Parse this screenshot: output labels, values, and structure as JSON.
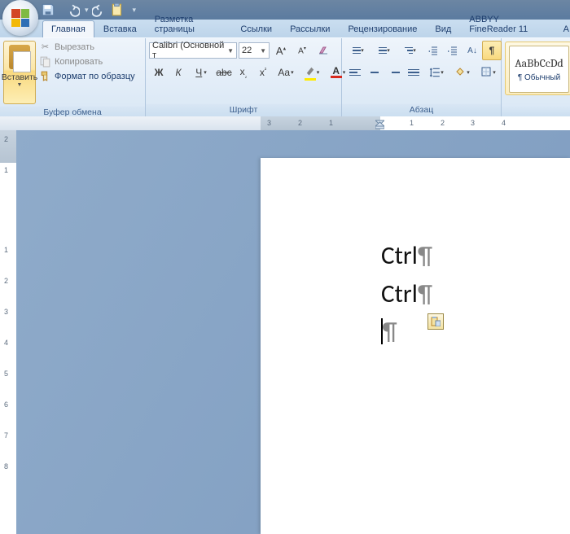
{
  "qat": {
    "save": "save",
    "undo": "undo",
    "redo": "redo",
    "newdoc": "newdoc"
  },
  "tabs": {
    "home": "Главная",
    "insert": "Вставка",
    "layout": "Разметка страницы",
    "refs": "Ссылки",
    "mail": "Рассылки",
    "review": "Рецензирование",
    "view": "Вид",
    "abbyy": "ABBYY FineReader 11",
    "addin": "A"
  },
  "clipboard": {
    "paste": "Вставить",
    "cut": "Вырезать",
    "copy": "Копировать",
    "fmt": "Формат по образцу",
    "group": "Буфер обмена"
  },
  "font": {
    "name": "Calibri (Основной т",
    "size": "22",
    "group": "Шрифт",
    "b": "Ж",
    "i": "К",
    "u": "Ч",
    "strike": "abc",
    "sub": "x",
    "sup": "x",
    "case": "Aa"
  },
  "para": {
    "group": "Абзац",
    "pilcrow": "¶"
  },
  "styles": {
    "sample": "AaBbCcDd",
    "name": "¶ Обычный"
  },
  "ruler": {
    "h": [
      "3",
      "2",
      "1",
      "1",
      "2",
      "3",
      "4"
    ],
    "v": [
      "2",
      "1",
      "1",
      "2",
      "3",
      "4",
      "5",
      "6",
      "7",
      "8"
    ]
  },
  "doc": {
    "l1": "Ctrl",
    "l2": "Ctrl",
    "pil": "¶"
  }
}
